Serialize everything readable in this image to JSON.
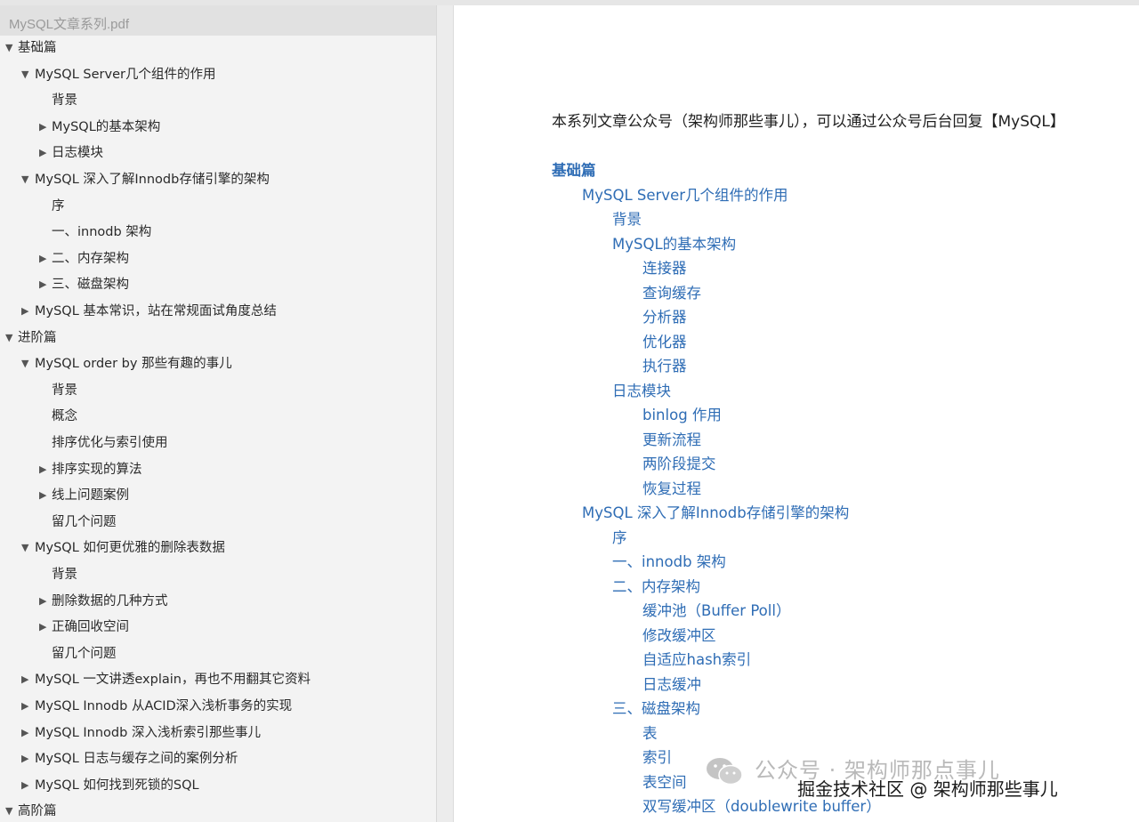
{
  "sidebar": {
    "file_title": "MySQL文章系列.pdf",
    "outline": [
      {
        "label": "基础篇",
        "level": 0,
        "state": "expanded"
      },
      {
        "label": "MySQL Server几个组件的作用",
        "level": 1,
        "state": "expanded"
      },
      {
        "label": "背景",
        "level": 2,
        "state": "leaf"
      },
      {
        "label": "MySQL的基本架构",
        "level": 2,
        "state": "collapsed"
      },
      {
        "label": "日志模块",
        "level": 2,
        "state": "collapsed"
      },
      {
        "label": "MySQL 深入了解Innodb存储引擎的架构",
        "level": 1,
        "state": "expanded"
      },
      {
        "label": "序",
        "level": 2,
        "state": "leaf"
      },
      {
        "label": "一、innodb 架构",
        "level": 2,
        "state": "leaf"
      },
      {
        "label": "二、内存架构",
        "level": 2,
        "state": "collapsed"
      },
      {
        "label": "三、磁盘架构",
        "level": 2,
        "state": "collapsed"
      },
      {
        "label": "MySQL 基本常识，站在常规面试角度总结",
        "level": 1,
        "state": "collapsed"
      },
      {
        "label": "进阶篇",
        "level": 0,
        "state": "expanded"
      },
      {
        "label": "MySQL order by 那些有趣的事儿",
        "level": 1,
        "state": "expanded"
      },
      {
        "label": "背景",
        "level": 2,
        "state": "leaf"
      },
      {
        "label": "概念",
        "level": 2,
        "state": "leaf"
      },
      {
        "label": "排序优化与索引使用",
        "level": 2,
        "state": "leaf"
      },
      {
        "label": "排序实现的算法",
        "level": 2,
        "state": "collapsed"
      },
      {
        "label": "线上问题案例",
        "level": 2,
        "state": "collapsed"
      },
      {
        "label": "留几个问题",
        "level": 2,
        "state": "leaf"
      },
      {
        "label": "MySQL 如何更优雅的删除表数据",
        "level": 1,
        "state": "expanded"
      },
      {
        "label": "背景",
        "level": 2,
        "state": "leaf"
      },
      {
        "label": "删除数据的几种方式",
        "level": 2,
        "state": "collapsed"
      },
      {
        "label": "正确回收空间",
        "level": 2,
        "state": "collapsed"
      },
      {
        "label": "留几个问题",
        "level": 2,
        "state": "leaf"
      },
      {
        "label": "MySQL 一文讲透explain，再也不用翻其它资料",
        "level": 1,
        "state": "collapsed"
      },
      {
        "label": "MySQL Innodb 从ACID深入浅析事务的实现",
        "level": 1,
        "state": "collapsed"
      },
      {
        "label": "MySQL Innodb 深入浅析索引那些事儿",
        "level": 1,
        "state": "collapsed"
      },
      {
        "label": "MySQL 日志与缓存之间的案例分析",
        "level": 1,
        "state": "collapsed"
      },
      {
        "label": "MySQL 如何找到死锁的SQL",
        "level": 1,
        "state": "collapsed"
      },
      {
        "label": "高阶篇",
        "level": 0,
        "state": "expanded"
      }
    ]
  },
  "page": {
    "intro": "本系列文章公众号（架构师那些事儿），可以通过公众号后台回复【MySQL】",
    "toc": [
      {
        "label": "基础篇",
        "level": 0
      },
      {
        "label": "MySQL Server几个组件的作用",
        "level": 1
      },
      {
        "label": "背景",
        "level": 2
      },
      {
        "label": "MySQL的基本架构",
        "level": 2
      },
      {
        "label": "连接器",
        "level": 3
      },
      {
        "label": "查询缓存",
        "level": 3
      },
      {
        "label": "分析器",
        "level": 3
      },
      {
        "label": "优化器",
        "level": 3
      },
      {
        "label": "执行器",
        "level": 3
      },
      {
        "label": "日志模块",
        "level": 2
      },
      {
        "label": "binlog 作用",
        "level": 3
      },
      {
        "label": "更新流程",
        "level": 3
      },
      {
        "label": "两阶段提交",
        "level": 3
      },
      {
        "label": "恢复过程",
        "level": 3
      },
      {
        "label": "MySQL 深入了解Innodb存储引擎的架构",
        "level": 1
      },
      {
        "label": "序",
        "level": 2
      },
      {
        "label": "一、innodb 架构",
        "level": 2
      },
      {
        "label": "二、内存架构",
        "level": 2
      },
      {
        "label": "缓冲池（Buffer Poll）",
        "level": 3
      },
      {
        "label": "修改缓冲区",
        "level": 3
      },
      {
        "label": "自适应hash索引",
        "level": 3
      },
      {
        "label": "日志缓冲",
        "level": 3
      },
      {
        "label": "三、磁盘架构",
        "level": 2
      },
      {
        "label": "表",
        "level": 3
      },
      {
        "label": "索引",
        "level": 3
      },
      {
        "label": "表空间",
        "level": 3
      },
      {
        "label": "双写缓冲区（doublewrite buffer）",
        "level": 3
      }
    ],
    "watermark": "公众号 · 架构师那点事儿",
    "credit": "掘金技术社区 @ 架构师那些事儿"
  },
  "colors": {
    "link": "#2f6db5",
    "sidebar_bg": "#f3f3f3",
    "header_bg": "#e1e1e1",
    "text": "#2a2a2a"
  },
  "icons": {
    "expanded": "disclosure-down-icon",
    "collapsed": "disclosure-right-icon",
    "watermark": "wechat-icon"
  }
}
